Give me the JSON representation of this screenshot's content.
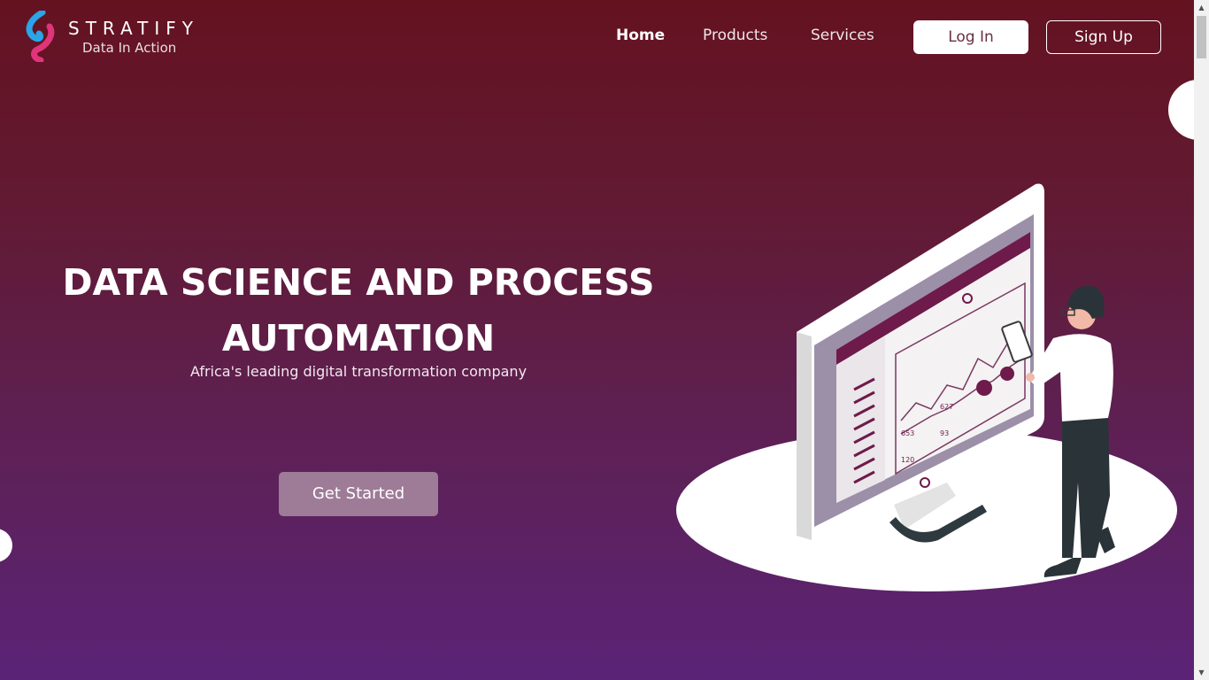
{
  "brand": {
    "name": "STRATIFY",
    "tagline": "Data In Action",
    "colors": {
      "accent_blue": "#2aa5e8",
      "accent_pink": "#e0357a"
    }
  },
  "nav": {
    "items": [
      {
        "label": "Home",
        "active": true
      },
      {
        "label": "Products",
        "active": false
      },
      {
        "label": "Services",
        "active": false
      }
    ],
    "login_label": "Log In",
    "signup_label": "Sign Up"
  },
  "hero": {
    "title_line1": "DATA SCIENCE AND PROCESS",
    "title_line2": "AUTOMATION",
    "subtitle": "Africa's leading digital transformation company",
    "cta_label": "Get Started"
  },
  "illustration": {
    "labels": [
      "653",
      "627",
      "93",
      "120"
    ]
  },
  "theme": {
    "background_top": "#641220",
    "background_bottom": "#5b2377",
    "cta_color": "#9e7b97"
  }
}
